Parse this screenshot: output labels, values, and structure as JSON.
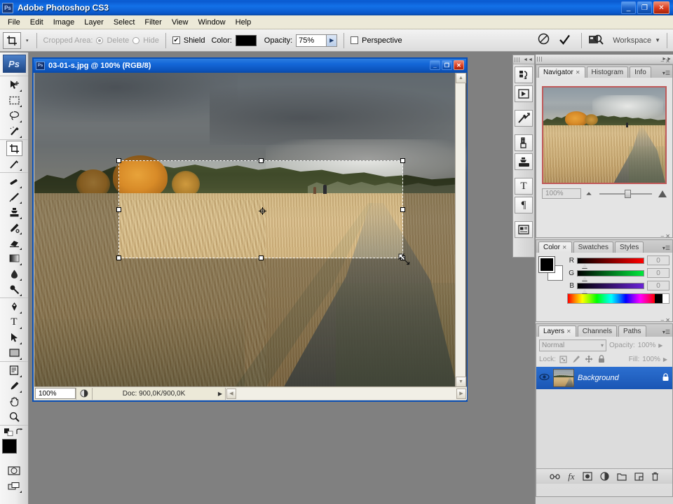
{
  "app": {
    "title": "Adobe Photoshop CS3",
    "logo": "Ps",
    "window_buttons": {
      "minimize": "_",
      "maximize": "❐",
      "close": "✕"
    }
  },
  "menubar": {
    "items": [
      "File",
      "Edit",
      "Image",
      "Layer",
      "Select",
      "Filter",
      "View",
      "Window",
      "Help"
    ]
  },
  "options_bar": {
    "tool_icon": "crop-tool-icon",
    "preset_arrow": "▾",
    "cropped_area_label": "Cropped Area:",
    "delete_label": "Delete",
    "hide_label": "Hide",
    "shield_label": "Shield",
    "shield_checked": "✔",
    "color_label": "Color:",
    "shield_color": "#000000",
    "opacity_label": "Opacity:",
    "opacity_value": "75%",
    "opacity_arrow": "▶",
    "perspective_label": "Perspective",
    "cancel_icon": "⊘",
    "commit_icon": "✓",
    "bridge_icon": "bridge-icon",
    "workspace_label": "Workspace",
    "workspace_arrow": "▼"
  },
  "toolbox": {
    "logo": "Ps",
    "selected_tool": "crop-tool",
    "tools": [
      "move-tool",
      "rectangular-marquee-tool",
      "lasso-tool",
      "magic-wand-tool",
      "crop-tool",
      "eyedropper-tool",
      "healing-brush-tool",
      "brush-tool",
      "clone-stamp-tool",
      "history-brush-tool",
      "eraser-tool",
      "gradient-tool",
      "blur-tool",
      "dodge-tool",
      "pen-tool",
      "type-tool",
      "path-selection-tool",
      "shape-tool",
      "notes-tool",
      "eyedropper-tool-2",
      "hand-tool",
      "zoom-tool"
    ],
    "type_glyph": "T",
    "paragraph_glyph": "¶",
    "foreground_color": "#000000",
    "background_color": "#ffffff"
  },
  "document": {
    "title": "03-01-s.jpg @ 100% (RGB/8)",
    "icon": "ps-document-icon",
    "window_buttons": {
      "minimize": "_",
      "maximize": "❐",
      "close": "✕"
    },
    "status": {
      "zoom": "100%",
      "doc_info": "Doc: 900,0K/900,0K",
      "arrow": "▶"
    },
    "crop": {
      "handles": 8,
      "center_icon": "rotation-center-icon",
      "cursor": "resize-corner-cursor",
      "shield_opacity": "75%"
    }
  },
  "icon_dock": {
    "collapse_arrow": "◄◄",
    "expand_arrow": "►►",
    "items": [
      "history-icon",
      "actions-icon",
      "tool-presets-icon",
      "brushes-icon",
      "clone-source-icon",
      "character-icon",
      "paragraph-icon",
      "layer-comps-icon"
    ]
  },
  "navigator_panel": {
    "tabs": [
      {
        "label": "Navigator",
        "active": true,
        "closable": true
      },
      {
        "label": "Histogram",
        "active": false,
        "closable": false
      },
      {
        "label": "Info",
        "active": false,
        "closable": false
      }
    ],
    "zoom_value": "100%",
    "view_box_color": "#c05a5a",
    "zoom_out_icon": "small-mountain-icon",
    "zoom_in_icon": "large-mountain-icon",
    "menu_icon": "panel-menu-icon"
  },
  "color_panel": {
    "tabs": [
      {
        "label": "Color",
        "active": true,
        "closable": true
      },
      {
        "label": "Swatches",
        "active": false,
        "closable": false
      },
      {
        "label": "Styles",
        "active": false,
        "closable": false
      }
    ],
    "foreground": "#000000",
    "background": "#ffffff",
    "channels": [
      {
        "label": "R",
        "value": "0"
      },
      {
        "label": "G",
        "value": "0"
      },
      {
        "label": "B",
        "value": "0"
      }
    ]
  },
  "layers_panel": {
    "tabs": [
      {
        "label": "Layers",
        "active": true,
        "closable": true
      },
      {
        "label": "Channels",
        "active": false,
        "closable": false
      },
      {
        "label": "Paths",
        "active": false,
        "closable": false
      }
    ],
    "blend_mode": "Normal",
    "blend_arrow": "▾",
    "opacity_label": "Opacity:",
    "opacity_value": "100%",
    "opacity_arrow": "▶",
    "lock_label": "Lock:",
    "lock_icons": [
      "lock-transparency-icon",
      "lock-image-icon",
      "lock-position-icon",
      "lock-all-icon"
    ],
    "fill_label": "Fill:",
    "fill_value": "100%",
    "fill_arrow": "▶",
    "layers": [
      {
        "name": "Background",
        "visible": true,
        "locked": true,
        "selected": true
      }
    ],
    "eye_icon": "eye-icon",
    "layer_lock_icon": "lock-icon",
    "bottom_buttons": [
      "link-layers-icon",
      "layer-style-fx-icon",
      "layer-mask-icon",
      "adjustment-layer-icon",
      "new-group-icon",
      "new-layer-icon",
      "delete-layer-icon"
    ],
    "fx_glyph": "fx"
  }
}
